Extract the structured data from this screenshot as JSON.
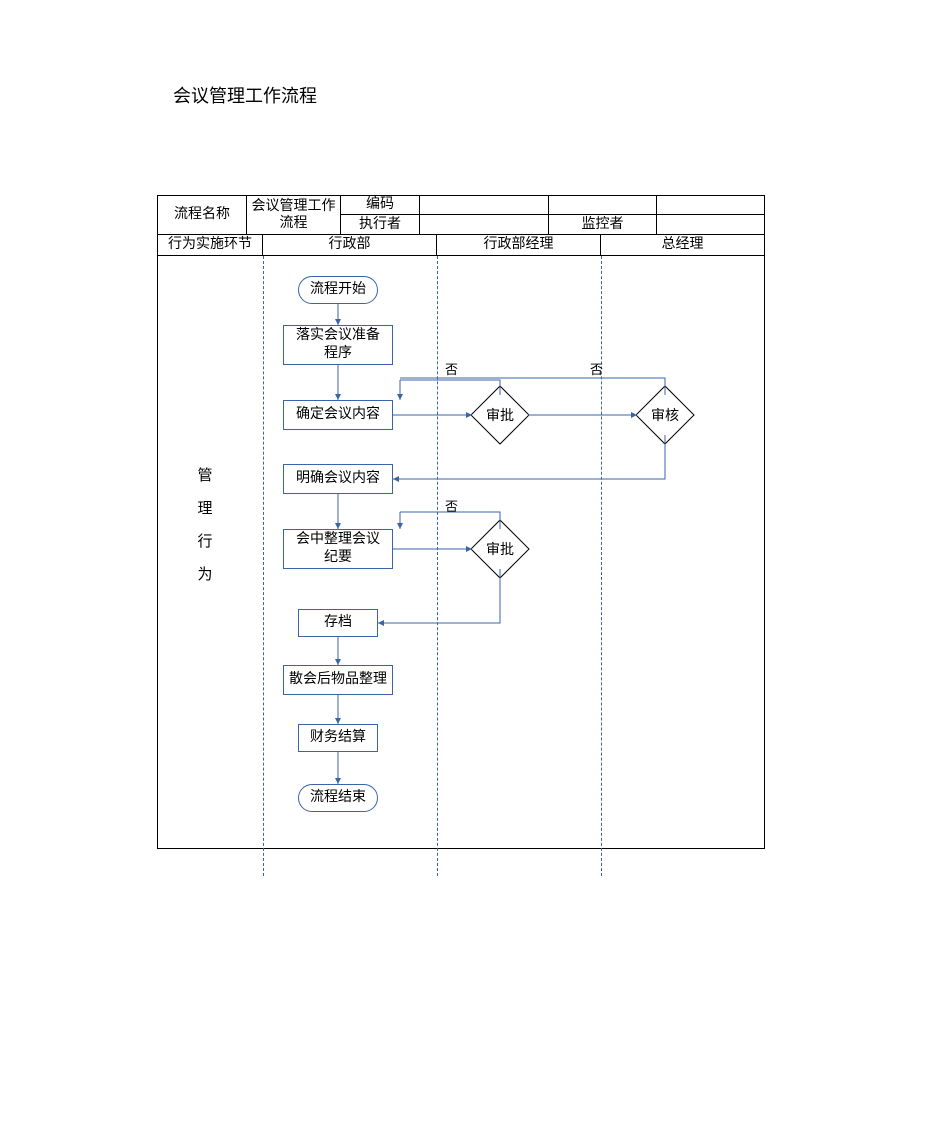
{
  "title": "会议管理工作流程",
  "header": {
    "process_name_label": "流程名称",
    "process_name_value": "会议管理工作流程",
    "code_label": "编码",
    "executor_label": "执行者",
    "monitor_label": "监控者",
    "row2_label": "行为实施环节",
    "lane_admin": "行政部",
    "lane_admin_mgr": "行政部经理",
    "lane_gm": "总经理"
  },
  "side_label": "管\n理\n行\n为",
  "nodes": {
    "start": "流程开始",
    "prep": "落实会议准备\n程序",
    "determine": "确定会议内容",
    "clarify": "明确会议内容",
    "minutes": "会中整理会议\n纪要",
    "archive": "存档",
    "cleanup": "散会后物品整理",
    "finance": "财务结算",
    "end": "流程结束",
    "approve1": "审批",
    "approve2": "审批",
    "audit": "审核"
  },
  "edge_labels": {
    "no1": "否",
    "no2": "否",
    "no3": "否"
  }
}
